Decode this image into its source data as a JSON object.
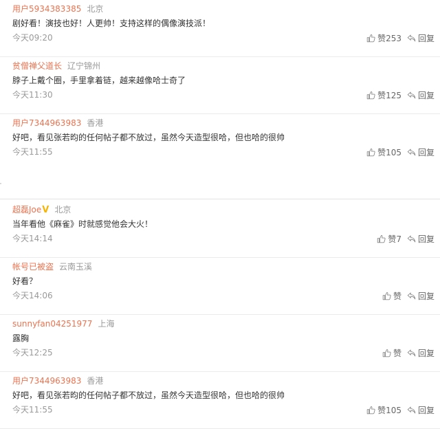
{
  "actions": {
    "reply_label": "回复",
    "like_icon": "thumbs-up-icon",
    "reply_icon": "reply-icon"
  },
  "colors": {
    "username": "#eb7350",
    "meta": "#999999",
    "text": "#333333",
    "verified_badge": "#f7b400"
  },
  "comments_top": [
    {
      "user": "用户5934383385",
      "location": "北京",
      "text": "剧好看！演技也好！人更帅！支持这样的偶像演技派！",
      "time": "今天09:20",
      "likes": "赞253"
    },
    {
      "user": "贫僧禅父道长",
      "location": "辽宁锦州",
      "text": "脖子上戴个圈，手里拿着链，越来越像哈士奇了",
      "time": "今天11:30",
      "likes": "赞125"
    },
    {
      "user": "用户7344963983",
      "location": "香港",
      "text": "好吧，看见张若昀的任何帖子都不放过，虽然今天造型很哈，但也哈的很帅",
      "time": "今天11:55",
      "likes": "赞105"
    }
  ],
  "comments_bottom": [
    {
      "user": "超磊Joe",
      "verified": "V",
      "location": "北京",
      "text": "当年看他《麻雀》时就感觉他会大火！",
      "time": "今天14:14",
      "likes": "赞7"
    },
    {
      "user": "帐号已被盗",
      "location": "云南玉溪",
      "text": "好看？",
      "time": "今天14:06",
      "likes": "赞"
    },
    {
      "user": "sunnyfan04251977",
      "location": "上海",
      "text": "露胸",
      "time": "今天12:25",
      "likes": "赞"
    },
    {
      "user": "用户7344963983",
      "location": "香港",
      "text": "好吧，看见张若昀的任何帖子都不放过，虽然今天造型很哈，但也哈的很帅",
      "time": "今天11:55",
      "likes": "赞105"
    }
  ]
}
